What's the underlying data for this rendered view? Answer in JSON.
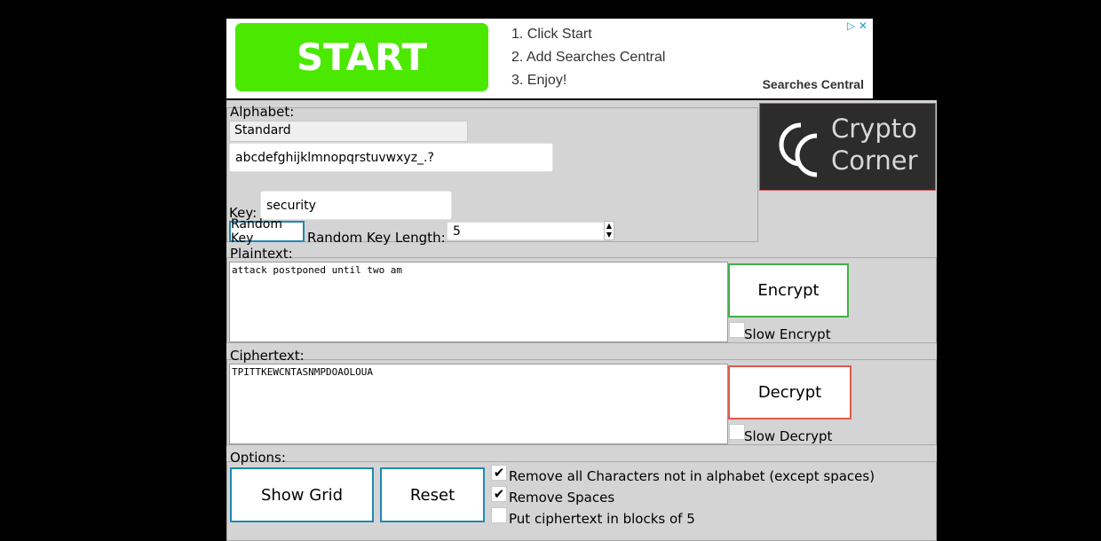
{
  "ad": {
    "start_label": "START",
    "steps": [
      "1. Click Start",
      "2. Add Searches Central",
      "3. Enjoy!"
    ],
    "brand": "Searches Central",
    "choices_icon": "ad-choices-icon"
  },
  "logo": {
    "line1": "Crypto",
    "line2": "Corner"
  },
  "alphabet": {
    "label": "Alphabet:",
    "preset": "Standard",
    "value": "abcdefghijklmnopqrstuvwxyz_.?"
  },
  "key": {
    "label": "Key:",
    "value": "security",
    "random_button": "Random Key",
    "length_label": "Random Key Length:",
    "length_value": "5"
  },
  "plaintext": {
    "label": "Plaintext:",
    "value": "attack postponed until two am",
    "encrypt_button": "Encrypt",
    "slow_label": "Slow Encrypt"
  },
  "ciphertext": {
    "label": "Ciphertext:",
    "value": "TPITTKEWCNTASNMPDOAOLOUA",
    "decrypt_button": "Decrypt",
    "slow_label": "Slow Decrypt"
  },
  "options": {
    "label": "Options:",
    "show_grid_button": "Show Grid",
    "reset_button": "Reset",
    "checks": [
      {
        "label": "Remove all Characters not in alphabet (except spaces)",
        "checked": true
      },
      {
        "label": "Remove Spaces",
        "checked": true
      },
      {
        "label": "Put ciphertext in blocks of 5",
        "checked": false
      }
    ]
  },
  "colors": {
    "encrypt_border": "#43b047",
    "decrypt_border": "#e05a4f",
    "accent": "#1e88b4",
    "ad_green": "#4be800"
  }
}
